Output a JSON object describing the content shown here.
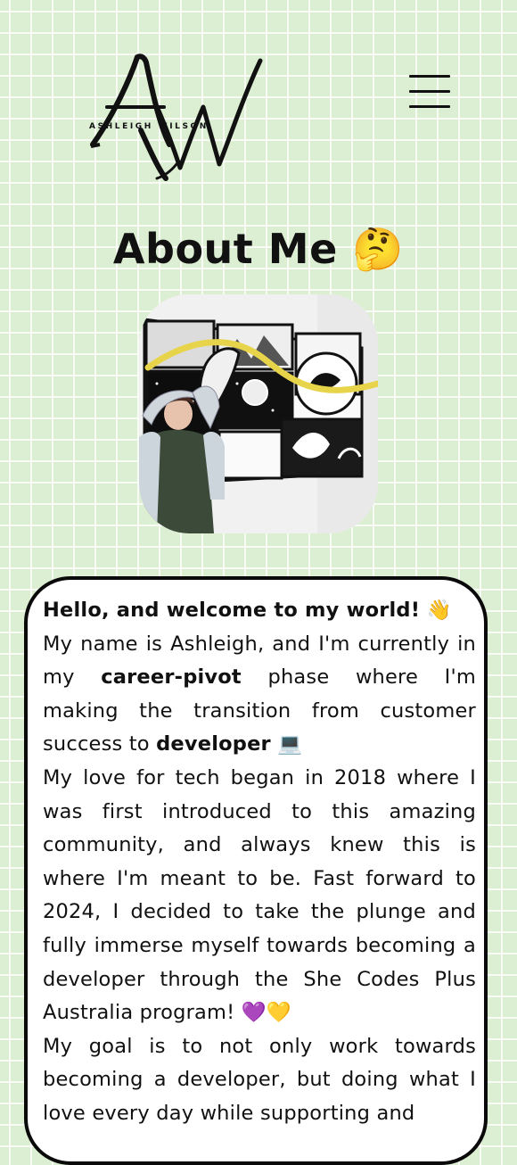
{
  "header": {
    "logo_name": "ASHLEIGH WILSON",
    "logo_monogram": "AW",
    "menu_icon": "hamburger-menu-icon"
  },
  "page": {
    "title": "About Me",
    "title_emoji": "🤔"
  },
  "about": {
    "greeting": "Hello, and welcome to my world!",
    "greeting_emoji": "👋",
    "p1_before": "My name is Ashleigh, and I'm currently in my ",
    "p1_bold1": "career-pivot",
    "p1_middle": " phase where I'm making the transition from customer success to ",
    "p1_bold2": "developer",
    "p1_emoji": "💻",
    "p2": "My love for tech began in 2018 where I was first introduced to this amazing community, and always knew this is where I'm meant to be. Fast forward to 2024, I decided to take the plunge and fully immerse myself towards becoming a developer through the She Codes Plus Australia program!",
    "p2_emoji": "💜💛",
    "p3": "My goal is to not only work towards becoming a developer, but doing what I love every day while supporting and"
  },
  "colors": {
    "background": "#dcefd2",
    "grid_lines": "#ffffff",
    "card_background": "#ffffff",
    "card_border": "#0a0a0a",
    "text": "#111111",
    "mural_yellow": "#e8d44a"
  }
}
